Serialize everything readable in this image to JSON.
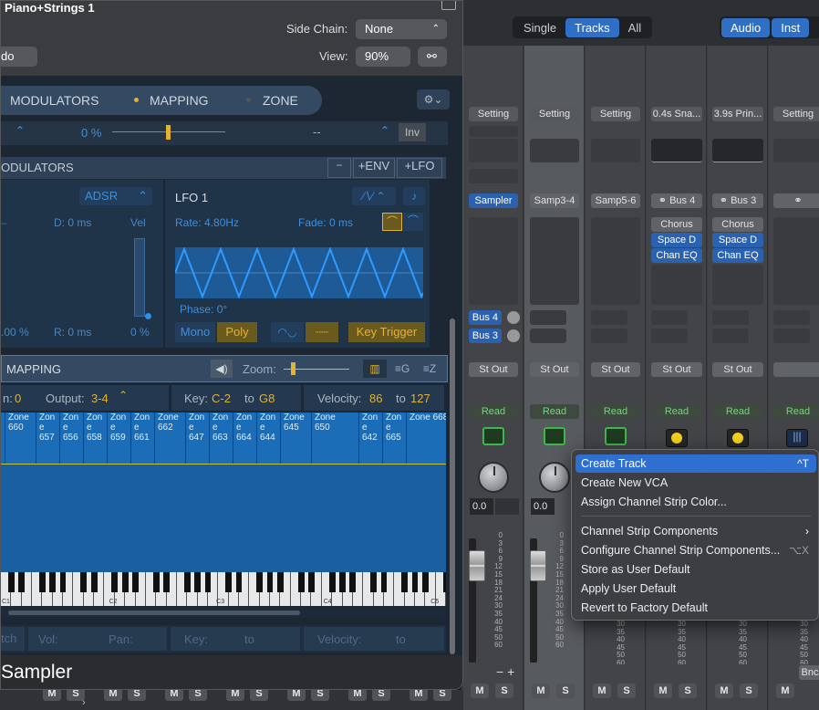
{
  "plugin": {
    "window_title": "Piano+Strings 1",
    "undo_partial": "do",
    "side_chain_label": "Side Chain:",
    "side_chain_value": "None",
    "view_label": "View:",
    "view_value": "90%",
    "footer_title": "Sampler",
    "tabs": [
      "MODULATORS",
      "MAPPING",
      "ZONE"
    ],
    "mod_row": {
      "value": "0 %",
      "dashes": "--",
      "inv": "Inv"
    },
    "modulators_title": "ODULATORS",
    "mod_buttons": [
      "−",
      "+ENV",
      "+LFO"
    ],
    "adsr_label": "ADSR",
    "env": {
      "d_label": "D: 0 ms",
      "vel_label": "Vel",
      "s_label": ".00 %",
      "r_label": "R: 0 ms",
      "vel_pct": "0 %"
    },
    "lfo": {
      "title": "LFO 1",
      "rate": "Rate: 4.80Hz",
      "fade": "Fade: 0 ms",
      "phase": "Phase: 0°",
      "mono": "Mono",
      "poly": "Poly",
      "key_trigger": "Key Trigger"
    },
    "mapping": {
      "title": "MAPPING",
      "zoom_label": "Zoom:",
      "chan_label": "n:",
      "chan_value": "0",
      "output_label": "Output:",
      "output_value": "3-4",
      "key_label": "Key:",
      "key_from": "C-2",
      "key_to_label": "to",
      "key_to": "G8",
      "velocity_label": "Velocity:",
      "vel_from": "86",
      "vel_to_label": "to",
      "vel_to": "127",
      "zones": [
        {
          "l1": "Zone",
          "l2": "660",
          "l3": ""
        },
        {
          "l1": "Zon",
          "l2": "e",
          "l3": "657"
        },
        {
          "l1": "Zon",
          "l2": "e",
          "l3": "656"
        },
        {
          "l1": "Zon",
          "l2": "e",
          "l3": "658"
        },
        {
          "l1": "Zon",
          "l2": "e",
          "l3": "659"
        },
        {
          "l1": "Zon",
          "l2": "e",
          "l3": "661"
        },
        {
          "l1": "Zone",
          "l2": "662",
          "l3": ""
        },
        {
          "l1": "Zon",
          "l2": "e",
          "l3": "647"
        },
        {
          "l1": "Zon",
          "l2": "e",
          "l3": "663"
        },
        {
          "l1": "Zon",
          "l2": "e",
          "l3": "664"
        },
        {
          "l1": "Zon",
          "l2": "e",
          "l3": "644"
        },
        {
          "l1": "Zone",
          "l2": "645",
          "l3": ""
        },
        {
          "l1": "Zone",
          "l2": "650",
          "l3": ""
        },
        {
          "l1": "Zon",
          "l2": "e",
          "l3": "642"
        },
        {
          "l1": "Zon",
          "l2": "e",
          "l3": "665"
        },
        {
          "l1": "Zone 668",
          "l2": "",
          "l3": ""
        }
      ],
      "octaves": [
        "C1",
        "C2",
        "C3",
        "C4",
        "C5"
      ],
      "bottom": {
        "tch": "tch",
        "vol": "Vol:",
        "pan": "Pan:",
        "key": "Key:",
        "to1": "to",
        "velocity": "Velocity:",
        "to2": "to"
      }
    }
  },
  "mixer": {
    "view_tabs": [
      "Single",
      "Tracks",
      "All"
    ],
    "type_tabs": [
      "Audio",
      "Inst"
    ],
    "strips": [
      {
        "setting": "Setting",
        "input": "Sampler",
        "sends": [
          "Bus 4",
          "Bus 3"
        ],
        "output": "St Out",
        "auto": "Read",
        "value": "0.0"
      },
      {
        "setting": "Setting",
        "input": "Samp3-4",
        "output": "St Out",
        "auto": "Read",
        "value": "0.0"
      },
      {
        "setting": "Setting",
        "input": "Samp5-6",
        "output": "St Out",
        "auto": "Read"
      },
      {
        "setting": "0.4s Sna...",
        "input": "Bus 4",
        "inserts": [
          "Chorus",
          "Space D",
          "Chan EQ"
        ],
        "output": "St Out",
        "auto": "Read"
      },
      {
        "setting": "3.9s Prin...",
        "input": "Bus 3",
        "inserts": [
          "Chorus",
          "Space D",
          "Chan EQ"
        ],
        "output": "St Out",
        "auto": "Read"
      },
      {
        "setting": "Setting",
        "input": "",
        "output": "",
        "auto": "Read",
        "bottom": "Bnc"
      }
    ],
    "scale": [
      "0",
      "3",
      "6",
      "9",
      "12",
      "15",
      "18",
      "21",
      "24",
      "30",
      "35",
      "40",
      "45",
      "50",
      "60"
    ],
    "ms": {
      "m": "M",
      "s": "S"
    },
    "minus_plus": "− +"
  },
  "context_menu": {
    "items": [
      {
        "label": "Create Track",
        "shortcut": "^T"
      },
      {
        "label": "Create New VCA",
        "shortcut": ""
      },
      {
        "label": "Assign Channel Strip Color...",
        "shortcut": ""
      },
      {
        "label": "Channel Strip Components",
        "shortcut": ""
      },
      {
        "label": "Configure Channel Strip Components...",
        "shortcut": "⌥X"
      },
      {
        "label": "Store as User Default",
        "shortcut": ""
      },
      {
        "label": "Apply User Default",
        "shortcut": ""
      },
      {
        "label": "Revert to Factory Default",
        "shortcut": ""
      }
    ]
  },
  "colors": {
    "accent": "#2f6fc4",
    "yellow": "#e1b331",
    "zone_blue": "#1c6db8",
    "read_green": "#79d27c"
  }
}
